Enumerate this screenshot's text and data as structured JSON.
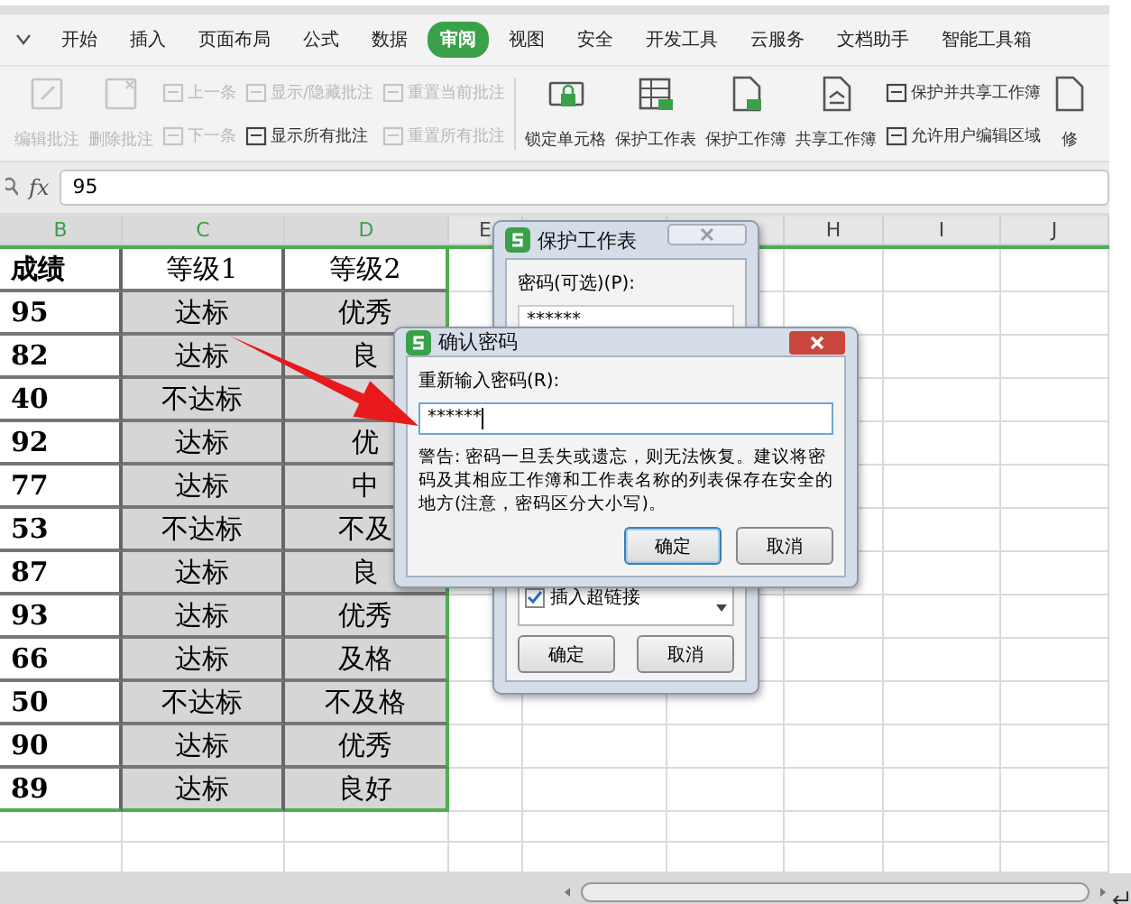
{
  "tabs": [
    {
      "label": "开始",
      "selected": false
    },
    {
      "label": "插入",
      "selected": false
    },
    {
      "label": "页面布局",
      "selected": false
    },
    {
      "label": "公式",
      "selected": false
    },
    {
      "label": "数据",
      "selected": false
    },
    {
      "label": "审阅",
      "selected": true
    },
    {
      "label": "视图",
      "selected": false
    },
    {
      "label": "安全",
      "selected": false
    },
    {
      "label": "开发工具",
      "selected": false
    },
    {
      "label": "云服务",
      "selected": false
    },
    {
      "label": "文档助手",
      "selected": false
    },
    {
      "label": "智能工具箱",
      "selected": false
    }
  ],
  "ribbon": {
    "groups": [
      {
        "columns": [
          {
            "kind": "large",
            "items": [
              {
                "label": "编辑批注",
                "disabled": true
              }
            ]
          },
          {
            "kind": "large",
            "items": [
              {
                "label": "删除批注",
                "disabled": true
              }
            ]
          },
          {
            "kind": "small",
            "items": [
              {
                "label": "上一条",
                "disabled": true
              },
              {
                "label": "下一条",
                "disabled": true
              }
            ]
          },
          {
            "kind": "small",
            "items": [
              {
                "label": "显示/隐藏批注",
                "disabled": true
              },
              {
                "label": "显示所有批注",
                "disabled": false
              }
            ]
          },
          {
            "kind": "small",
            "items": [
              {
                "label": "重置当前批注",
                "disabled": true
              },
              {
                "label": "重置所有批注",
                "disabled": true
              }
            ]
          }
        ]
      },
      {
        "columns": [
          {
            "kind": "large",
            "items": [
              {
                "label": "锁定单元格",
                "disabled": false
              }
            ]
          },
          {
            "kind": "large",
            "items": [
              {
                "label": "保护工作表",
                "disabled": false
              }
            ]
          },
          {
            "kind": "large",
            "items": [
              {
                "label": "保护工作簿",
                "disabled": false
              }
            ]
          },
          {
            "kind": "large",
            "items": [
              {
                "label": "共享工作簿",
                "disabled": false
              }
            ]
          },
          {
            "kind": "small",
            "items": [
              {
                "label": "保护并共享工作簿",
                "disabled": false
              },
              {
                "label": "允许用户编辑区域",
                "disabled": false
              }
            ]
          },
          {
            "kind": "large",
            "items": [
              {
                "label": "修",
                "disabled": false
              }
            ]
          }
        ]
      }
    ]
  },
  "formula_bar": {
    "label": "fx",
    "value": "95"
  },
  "sheet": {
    "columns": [
      {
        "label": "B"
      },
      {
        "label": "C"
      },
      {
        "label": "D"
      },
      {
        "label": "E"
      },
      {},
      {},
      {
        "label": "H"
      },
      {
        "label": "I"
      },
      {
        "label": "J"
      }
    ],
    "header": [
      "成绩",
      "等级1",
      "等级2"
    ],
    "rows": [
      {
        "score": "95",
        "level_1": "达标",
        "level_2": "优秀"
      },
      {
        "score": "82",
        "level_1": "达标",
        "level_2": "良"
      },
      {
        "score": "40",
        "level_1": "不达标"
      },
      {
        "score": "92",
        "level_1": "达标",
        "level_2": "优"
      },
      {
        "score": "77",
        "level_1": "达标",
        "level_2": "中"
      },
      {
        "score": "53",
        "level_1": "不达标",
        "level_2": "不及"
      },
      {
        "score": "87",
        "level_1": "达标",
        "level_2": "良"
      },
      {
        "score": "93",
        "level_1": "达标",
        "level_2": "优秀"
      },
      {
        "score": "66",
        "level_1": "达标",
        "level_2": "及格"
      },
      {
        "score": "50",
        "level_1": "不达标",
        "level_2": "不及格"
      },
      {
        "score": "90",
        "level_1": "达标",
        "level_2": "优秀"
      },
      {
        "score": "89",
        "level_1": "达标",
        "level_2": "良好"
      }
    ]
  },
  "protect_dialog": {
    "title": "保护工作表",
    "password_label": "密码(可选)(P):",
    "password_value": "******",
    "permissions": [
      {
        "label": "插入超链接",
        "checked": true
      }
    ],
    "buttons": [
      "确定",
      "取消"
    ]
  },
  "confirm_dialog": {
    "title": "确认密码",
    "label": "重新输入密码(R):",
    "value": "******",
    "warning": "警告: 密码一旦丢失或遗忘，则无法恢复。建议将密码及其相应工作簿和工作表名称的列表保存在安全的地方(注意，密码区分大小写)。",
    "buttons": [
      "确定",
      "取消"
    ]
  }
}
